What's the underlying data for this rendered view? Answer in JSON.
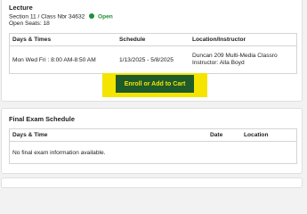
{
  "lecture": {
    "title": "Lecture",
    "section_prefix": "Section 11 / Class Nbr 34632",
    "status": "Open",
    "open_seats": "Open Seats: 18",
    "columns": [
      "Days & Times",
      "Schedule",
      "Location/Instructor"
    ],
    "row": {
      "days_times": "Mon Wed Fri : 8:00 AM-8:50 AM",
      "schedule": "1/13/2025 - 5/8/2025",
      "location": "Duncan 209 Multi-Media Classro",
      "instructor": "Instructor: Alla Boyd"
    },
    "enroll_label": "Enroll or Add to Cart",
    "highlight_color": "#f4e400",
    "status_color": "#1f8f3a"
  },
  "final_exam": {
    "title": "Final Exam Schedule",
    "columns": [
      "Days & Time",
      "Date",
      "Location"
    ],
    "empty_message": "No final exam information available."
  }
}
